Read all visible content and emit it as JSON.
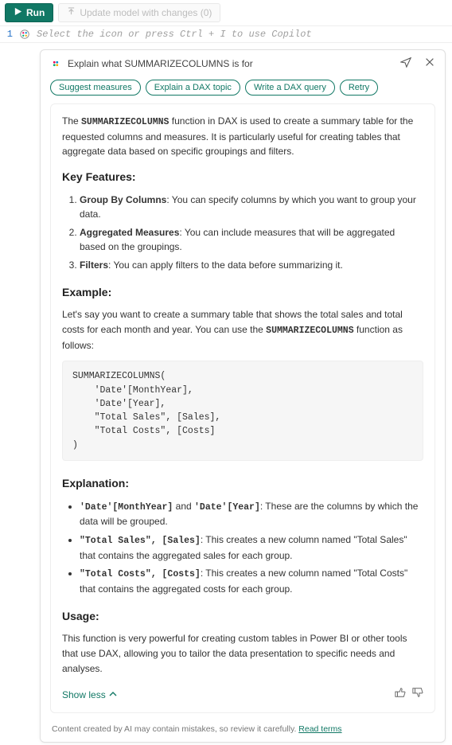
{
  "toolbar": {
    "run_label": "Run",
    "update_label": "Update model with changes (0)"
  },
  "editor": {
    "line": "1",
    "placeholder": "Select the icon or press Ctrl + I to use Copilot"
  },
  "panel": {
    "title": "Explain what SUMMARIZECOLUMNS is for",
    "chips": [
      "Suggest measures",
      "Explain a DAX topic",
      "Write a DAX query",
      "Retry"
    ]
  },
  "response": {
    "intro_pre": "The ",
    "intro_fn": "SUMMARIZECOLUMNS",
    "intro_post": " function in DAX is used to create a summary table for the requested columns and measures. It is particularly useful for creating tables that aggregate data based on specific groupings and filters.",
    "h_features": "Key Features:",
    "features": [
      {
        "b": "Group By Columns",
        "t": ": You can specify columns by which you want to group your data."
      },
      {
        "b": "Aggregated Measures",
        "t": ": You can include measures that will be aggregated based on the groupings."
      },
      {
        "b": "Filters",
        "t": ": You can apply filters to the data before summarizing it."
      }
    ],
    "h_example": "Example:",
    "example_pre": "Let's say you want to create a summary table that shows the total sales and total costs for each month and year. You can use the ",
    "example_fn": "SUMMARIZECOLUMNS",
    "example_post": " function as follows:",
    "code": "SUMMARIZECOLUMNS(\n    'Date'[MonthYear],\n    'Date'[Year],\n    \"Total Sales\", [Sales],\n    \"Total Costs\", [Costs]\n)",
    "h_explanation": "Explanation:",
    "explanation": [
      {
        "c1": "'Date'[MonthYear]",
        "mid": " and ",
        "c2": "'Date'[Year]",
        "t": ": These are the columns by which the data will be grouped."
      },
      {
        "c1": "\"Total Sales\", [Sales]",
        "mid": "",
        "c2": "",
        "t": ": This creates a new column named \"Total Sales\" that contains the aggregated sales for each group."
      },
      {
        "c1": "\"Total Costs\", [Costs]",
        "mid": "",
        "c2": "",
        "t": ": This creates a new column named \"Total Costs\" that contains the aggregated costs for each group."
      }
    ],
    "h_usage": "Usage:",
    "usage_text": "This function is very powerful for creating custom tables in Power BI or other tools that use DAX, allowing you to tailor the data presentation to specific needs and analyses.",
    "show_less": "Show less"
  },
  "disclaimer": {
    "text": "Content created by AI may contain mistakes, so review it carefully. ",
    "link": "Read terms"
  }
}
